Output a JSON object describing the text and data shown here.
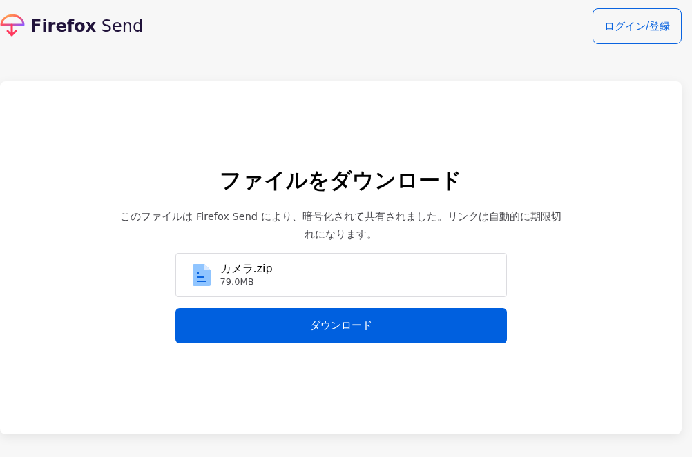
{
  "header": {
    "brand_bold": "Firefox",
    "brand_light": "Send",
    "login_button": "ログイン/登録"
  },
  "card": {
    "title": "ファイルをダウンロード",
    "description": "このファイルは Firefox Send により、暗号化されて共有されました。リンクは自動的に期限切れになります。",
    "file": {
      "name": "カメラ.zip",
      "size": "79.0MB"
    },
    "download_button": "ダウンロード"
  }
}
